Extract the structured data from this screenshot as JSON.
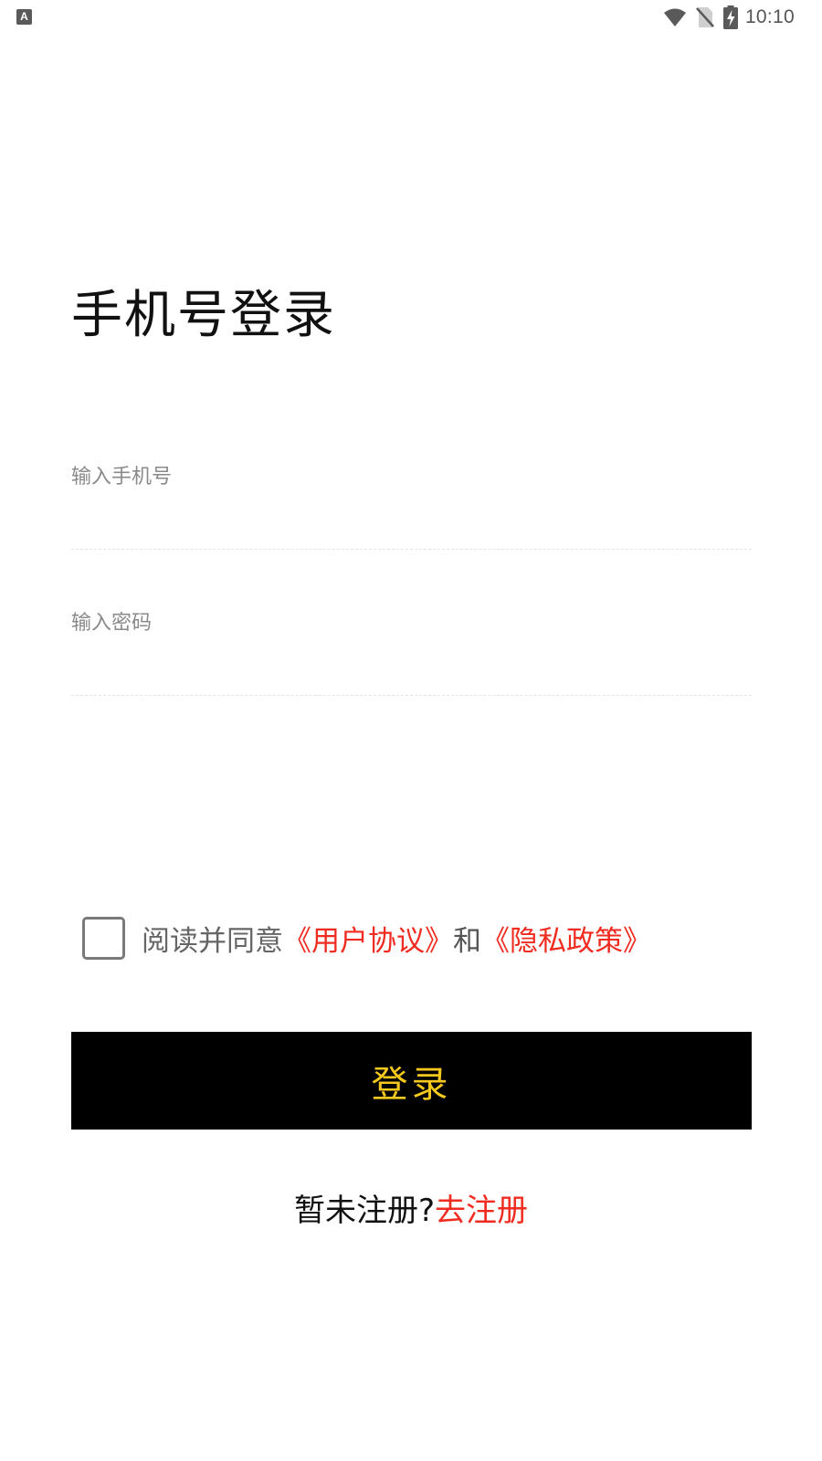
{
  "status_bar": {
    "left_icon": "A",
    "icons": [
      "wifi-icon",
      "no-sim-icon",
      "battery-charging-icon"
    ],
    "time": "10:10"
  },
  "title": "手机号登录",
  "phone_field": {
    "placeholder": "输入手机号",
    "value": ""
  },
  "password_field": {
    "placeholder": "输入密码",
    "value": ""
  },
  "agreement": {
    "checked": false,
    "prefix": "阅读并同意",
    "user_agreement": "《用户协议》",
    "conjunction": "和",
    "privacy_policy": "《隐私政策》"
  },
  "login_button": {
    "label": "登录"
  },
  "register": {
    "prompt": "暂未注册?",
    "link": "去注册"
  },
  "colors": {
    "link_red": "#f02b20",
    "button_bg": "#000000",
    "button_text": "#f4c81d",
    "placeholder_gray": "#8a8a8a"
  }
}
